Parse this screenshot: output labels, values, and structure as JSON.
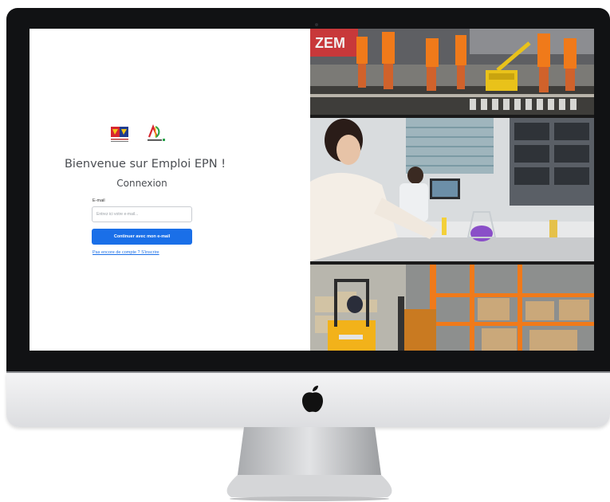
{
  "login": {
    "welcome_title": "Bienvenue sur Emploi EPN !",
    "subtitle": "Connexion",
    "email_label": "E-mail",
    "email_placeholder": "Entrez ici votre e-mail...",
    "email_value": "",
    "continue_button": "Continuer avec mon e-mail",
    "signup_link": "Pas encore de compte ? S'inscrire"
  },
  "colors": {
    "primary": "#1a6fe8",
    "text": "#4a4d52",
    "bezel": "#111214",
    "safety_orange": "#f07a1a"
  },
  "icons": [
    "region-logo-icon",
    "ad-logo-icon",
    "apple-logo-icon"
  ]
}
